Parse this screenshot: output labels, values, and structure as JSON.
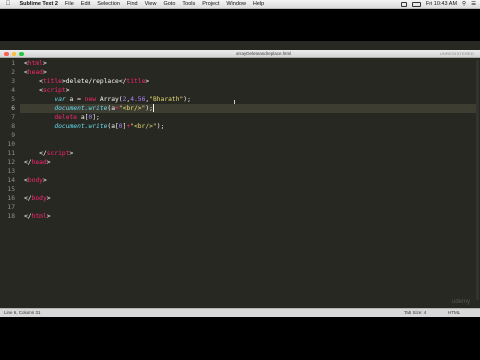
{
  "menubar": {
    "app_name": "Sublime Text 2",
    "items": [
      "File",
      "Edit",
      "Selection",
      "Find",
      "View",
      "Goto",
      "Tools",
      "Project",
      "Window",
      "Help"
    ],
    "clock": "Fri 10:43 AM"
  },
  "window": {
    "tab_title": "arrayDeleteandreplace.html",
    "unregistered": "UNREGISTERED"
  },
  "editor": {
    "lines": [
      "1",
      "2",
      "3",
      "4",
      "5",
      "6",
      "7",
      "8",
      "9",
      "10",
      "11",
      "12",
      "13",
      "14",
      "15",
      "16",
      "17",
      "18"
    ],
    "current_line": 6,
    "code": {
      "l3_title_text": "delete/replace",
      "l5_var": "var",
      "l5_rest_a": " a = ",
      "l5_new": "new",
      "l5_array": " Array(",
      "l5_n1": "2",
      "l5_c1": ",",
      "l5_n2": "4.56",
      "l5_c2": ",",
      "l5_s": "\"Bharath\"",
      "l5_end": ");",
      "l6_fn": "document.write",
      "l6_a": "(a",
      "l6_plus": "+",
      "l6_s": "\"<br/>\"",
      "l6_end": ");",
      "l7_kw": "delete",
      "l7_rest": " a[",
      "l7_n": "0",
      "l7_end": "];",
      "l8_fn": "document.write",
      "l8_a": "(a[",
      "l8_n": "0",
      "l8_b": "]",
      "l8_plus": "+",
      "l8_s": "\"<br/>\"",
      "l8_end": ");"
    }
  },
  "statusbar": {
    "position": "Line 6, Column 31",
    "tab_size": "Tab Size: 4",
    "syntax": "HTML"
  },
  "watermark": "udemy"
}
